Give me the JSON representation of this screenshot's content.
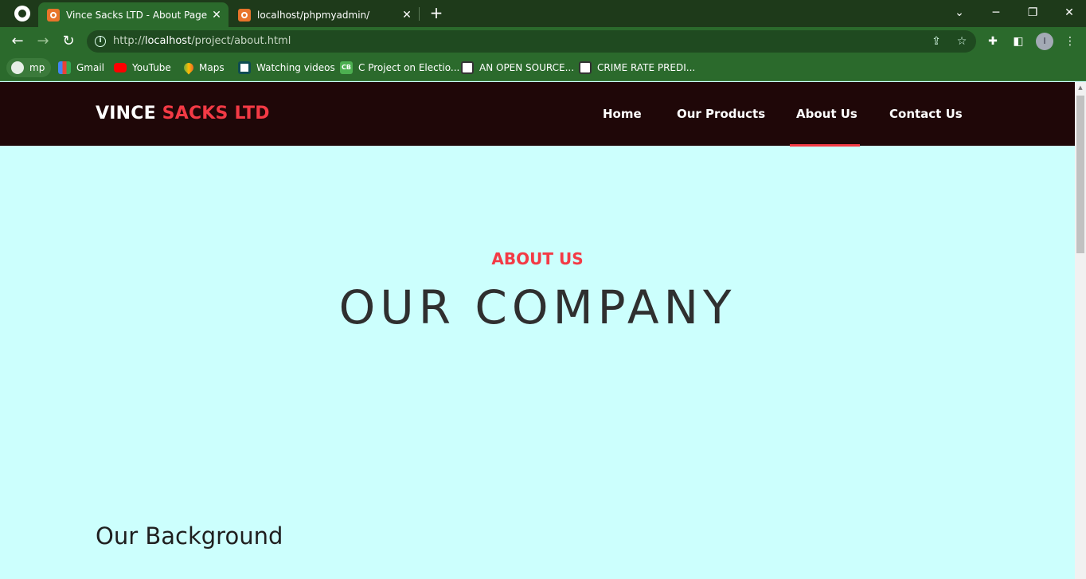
{
  "browser": {
    "tabs": [
      {
        "title": "Vince Sacks LTD - About Page",
        "active": true
      },
      {
        "title": "localhost/phpmyadmin/",
        "active": false
      }
    ],
    "url_prefix": "http://",
    "url_host": "localhost",
    "url_path": "/project/about.html",
    "avatar_letter": "I",
    "bookmarks": [
      {
        "label": "mp",
        "icon": "globe-icon"
      },
      {
        "label": "Gmail",
        "icon": "gmail-icon"
      },
      {
        "label": "YouTube",
        "icon": "youtube-icon"
      },
      {
        "label": "Maps",
        "icon": "maps-icon"
      },
      {
        "label": "Watching videos",
        "icon": "drop-icon"
      },
      {
        "label": "C Project on Electio...",
        "icon": "cb-icon"
      },
      {
        "label": "AN OPEN SOURCE...",
        "icon": "doc-icon"
      },
      {
        "label": "CRIME RATE PREDI...",
        "icon": "doc-icon"
      }
    ],
    "cb_icon_text": "CB"
  },
  "site": {
    "logo_primary": "VINCE",
    "logo_accent": "SACKS LTD",
    "nav": [
      {
        "label": "Home",
        "active": false
      },
      {
        "label": "Our Products",
        "active": false
      },
      {
        "label": "About Us",
        "active": true
      },
      {
        "label": "Contact Us",
        "active": false
      }
    ],
    "eyebrow": "ABOUT US",
    "hero_title": "OUR COMPANY",
    "section_heading": "Our Background"
  },
  "colors": {
    "tab_strip": "#1e3a1a",
    "toolbar": "#2b6a2c",
    "header_bg": "#1f0708",
    "accent": "#f33a45",
    "page_bg": "#ccfffd",
    "heading_text": "#2f2f2f"
  }
}
